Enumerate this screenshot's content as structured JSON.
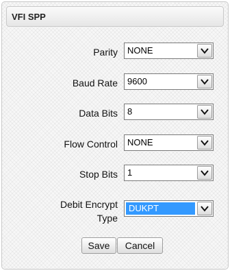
{
  "panel": {
    "title": "VFI SPP"
  },
  "fields": [
    {
      "label": "Parity",
      "value": "NONE"
    },
    {
      "label": "Baud Rate",
      "value": "9600"
    },
    {
      "label": "Data Bits",
      "value": "8"
    },
    {
      "label": "Flow Control",
      "value": "NONE"
    },
    {
      "label": "Stop Bits",
      "value": "1"
    },
    {
      "label_line1": "Debit Encrypt",
      "label_line2": "Type",
      "value": "DUKPT"
    }
  ],
  "buttons": {
    "save": "Save",
    "cancel": "Cancel"
  },
  "colors": {
    "selection_highlight": "#3399ff"
  },
  "icons": {
    "dropdown": "chevron-down-icon"
  }
}
